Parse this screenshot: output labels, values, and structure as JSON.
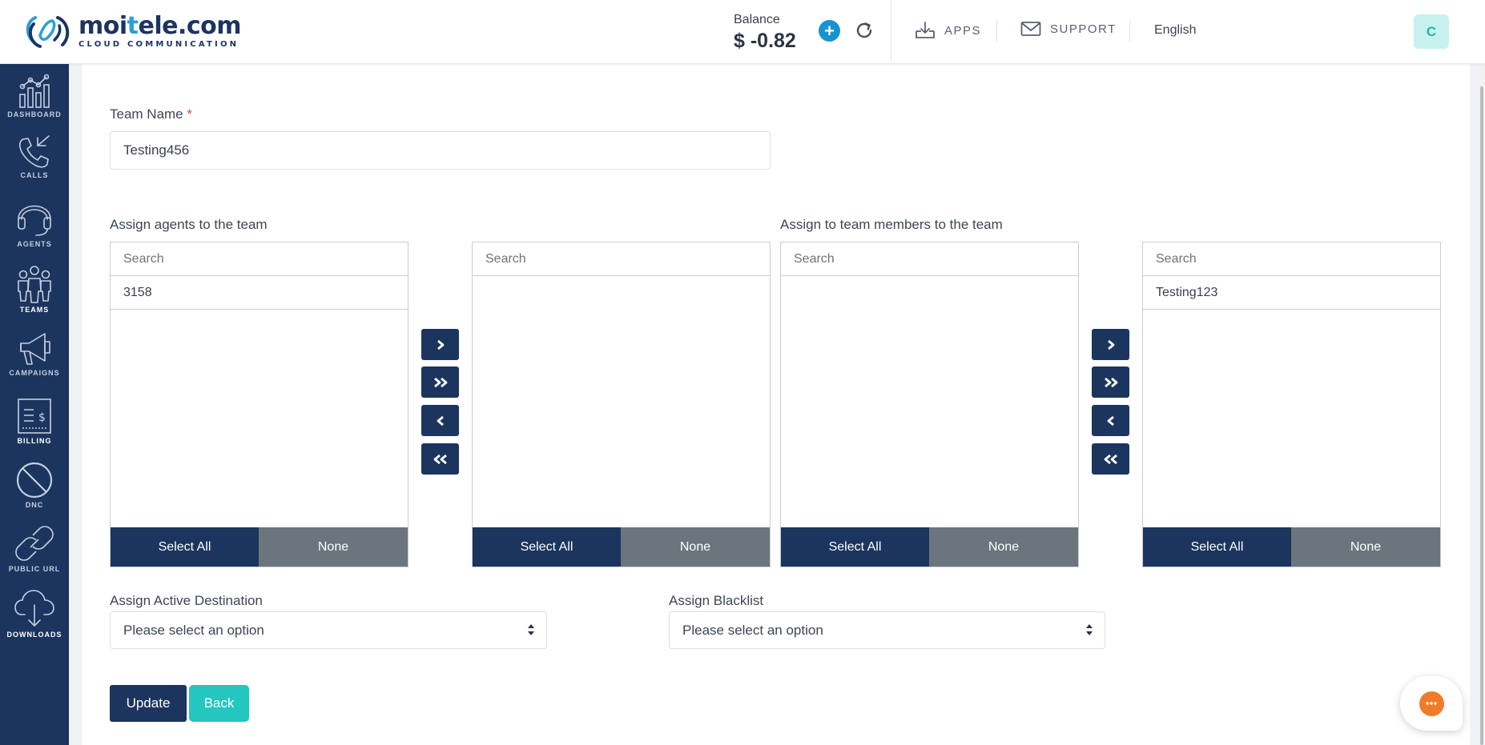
{
  "brand": {
    "name_prefix": "moi",
    "name_highlight": "t",
    "name_suffix": "ele.com",
    "tagline": "CLOUD COMMUNICATION"
  },
  "header": {
    "balance_label": "Balance",
    "balance_value": "$ -0.82",
    "add_funds_symbol": "+",
    "apps_label": "APPS",
    "support_label": "SUPPORT",
    "language": "English",
    "avatar_initial": "C"
  },
  "sidebar": {
    "items": [
      {
        "label": "DASHBOARD",
        "icon": "dashboard-chart-icon"
      },
      {
        "label": "CALLS",
        "icon": "phone-calls-icon"
      },
      {
        "label": "AGENTS",
        "icon": "headset-icon"
      },
      {
        "label": "TEAMS",
        "icon": "team-people-icon"
      },
      {
        "label": "CAMPAIGNS",
        "icon": "megaphone-icon"
      },
      {
        "label": "BILLING",
        "icon": "billing-invoice-icon"
      },
      {
        "label": "DNC",
        "icon": "do-not-call-icon"
      },
      {
        "label": "PUBLIC URL",
        "icon": "link-icon"
      },
      {
        "label": "DOWNLOADS",
        "icon": "cloud-download-icon"
      }
    ]
  },
  "form": {
    "team_name_label": "Team Name",
    "required_mark": "*",
    "team_name_value": "Testing456",
    "agents_section_label": "Assign agents to the team",
    "members_section_label": "Assign to team members to the team",
    "listboxes": [
      {
        "search_placeholder": "Search",
        "options": [
          "3158"
        ],
        "select_all": "Select All",
        "none": "None"
      },
      {
        "search_placeholder": "Search",
        "options": [],
        "select_all": "Select All",
        "none": "None"
      },
      {
        "search_placeholder": "Search",
        "options": [],
        "select_all": "Select All",
        "none": "None"
      },
      {
        "search_placeholder": "Search",
        "options": [
          "Testing123"
        ],
        "select_all": "Select All",
        "none": "None"
      }
    ],
    "destination_label": "Assign Active Destination",
    "destination_value": "Please select an option",
    "blacklist_label": "Assign Blacklist",
    "blacklist_value": "Please select an option",
    "update_button": "Update",
    "back_button": "Back"
  },
  "colors": {
    "navy": "#1c355e",
    "teal": "#25c5c0",
    "gray_button": "#6c757e",
    "accent_blue": "#1793d1",
    "chat_orange": "#f07b2a"
  }
}
